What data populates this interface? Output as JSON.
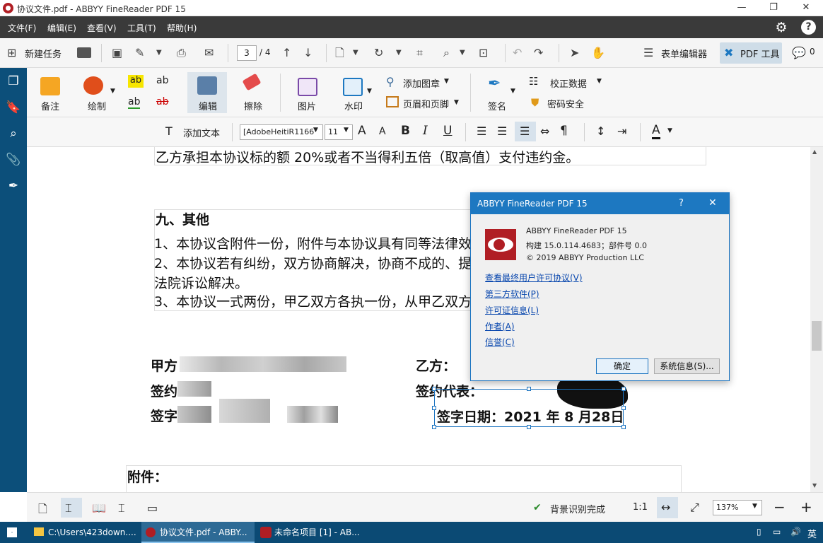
{
  "window": {
    "title": "协议文件.pdf - ABBYY FineReader PDF 15",
    "minimize": "—",
    "maximize": "❐",
    "close": "✕"
  },
  "menu": [
    "文件(F)",
    "编辑(E)",
    "查看(V)",
    "工具(T)",
    "帮助(H)"
  ],
  "toolbar": {
    "new_task": "新建任务",
    "page_current": "3",
    "page_total": "/ 4",
    "form_editor": "表单编辑器",
    "pdf_tools": "PDF 工具",
    "comments_count": "0"
  },
  "ribbon": {
    "note": "备注",
    "draw": "绘制",
    "edit": "编辑",
    "erase": "擦除",
    "image": "图片",
    "watermark": "水印",
    "add_stamp": "添加图章",
    "header_footer": "页眉和页脚",
    "sign": "签名",
    "correct_data": "校正数据",
    "password_security": "密码安全"
  },
  "format": {
    "add_text": "添加文本",
    "font": "[AdobeHeitiR1166",
    "size": "11"
  },
  "document": {
    "line_top": "乙方承担本协议标的额 20%或者不当得利五倍（取高值）支付违约金。",
    "section_title": "九、其他",
    "item1": "1、本协议含附件一份，附件与本协议具有同等法律效",
    "item2": "2、本协议若有纠纷，双方协商解决，协商不成的、提",
    "item2b": "法院诉讼解决。",
    "item3": "3、本协议一式两份，甲乙双方各执一份，从甲乙双方",
    "party_a": "甲方",
    "sign_a": "签约",
    "signature_a": "签字",
    "party_b": "乙方：",
    "sign_rep_b": "签约代表：",
    "sign_date": "签字日期：2021 年 8 月28日",
    "attachment": "附件："
  },
  "dialog": {
    "title": "ABBYY FineReader PDF 15",
    "help": "?",
    "close": "✕",
    "product": "ABBYY FineReader PDF 15",
    "build": "构建 15.0.114.4683；部件号 0.0",
    "copyright": "© 2019 ABBYY Production LLC",
    "links": [
      "查看最终用户许可协议(V)",
      "第三方软件(P)",
      "许可证信息(L)",
      "作者(A)",
      "信誉(C)"
    ],
    "ok": "确定",
    "sysinfo": "系统信息(S)..."
  },
  "status": {
    "bg_recognition": "背景识别完成",
    "ratio": "1:1",
    "zoom": "137%"
  },
  "taskbar": {
    "items": [
      "C:\\Users\\423down....",
      "协议文件.pdf - ABBY...",
      "未命名项目 [1] - AB..."
    ],
    "ime": "英"
  },
  "colors": {
    "menubar": "#3a3a3a",
    "sidebar": "#0c4f7a",
    "taskbar": "#0b4a74",
    "dialog_title": "#1d78c1",
    "brand_red": "#b01e24"
  }
}
